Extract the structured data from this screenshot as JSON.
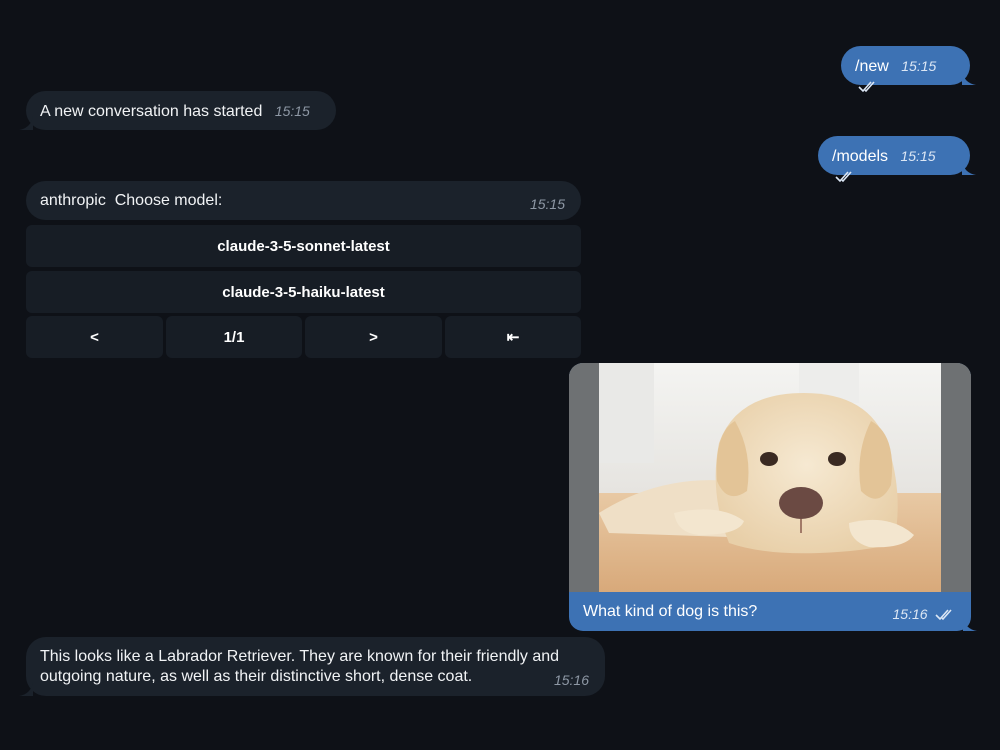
{
  "messages": {
    "cmd_new": {
      "text": "/new",
      "time": "15:15"
    },
    "started": {
      "text": "A new conversation has started",
      "time": "15:15"
    },
    "cmd_models": {
      "text": "/models",
      "time": "15:15"
    },
    "choose": {
      "text": "anthropic  Choose model:",
      "time": "15:15"
    },
    "photo_caption": {
      "text": "What kind of dog is this?",
      "time": "15:16"
    },
    "answer": {
      "line1": "This looks like a Labrador Retriever. They are known for their friendly and",
      "line2": "outgoing nature, as well as their distinctive short, dense coat.",
      "time": "15:16"
    }
  },
  "keyboard": {
    "models": [
      "claude-3-5-sonnet-latest",
      "claude-3-5-haiku-latest"
    ],
    "nav": {
      "prev": "<",
      "page": "1/1",
      "next": ">",
      "first": "⇤"
    }
  },
  "colors": {
    "background": "#0e1117",
    "incoming_bubble": "#1b222b",
    "outgoing_bubble": "#3d72b4",
    "keyboard_button": "#171d25"
  }
}
